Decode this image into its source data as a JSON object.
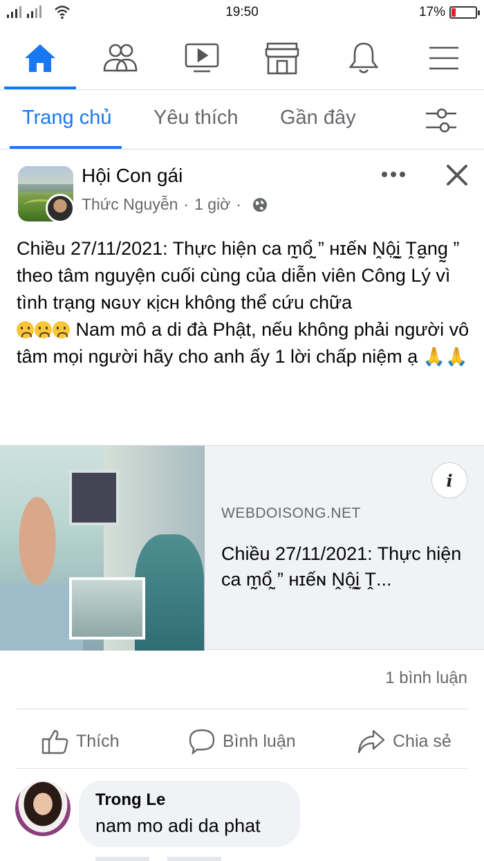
{
  "status_bar": {
    "time": "19:50",
    "battery_percent": "17%",
    "battery_level": 0.17,
    "battery_color": "#e0202a"
  },
  "top_nav": {
    "icons": [
      "home-icon",
      "friends-icon",
      "watch-icon",
      "marketplace-icon",
      "notifications-bell-icon",
      "menu-icon"
    ],
    "active_index": 0,
    "accent_color": "#1877f2"
  },
  "tabs": {
    "items": [
      "Trang chủ",
      "Yêu thích",
      "Gần đây"
    ],
    "active_index": 0,
    "filter_icon": "filter-sliders-icon"
  },
  "post": {
    "group_name": "Hội Con gái",
    "author": "Thức Nguyễn",
    "time": "1 giờ",
    "privacy_icon": "globe-icon",
    "text_line1": "Chiều 27/11/2021: Thực hiện ca m̰ổ̰ ” ʜɪếɴ Ṋộ̰ḭ Ṱa̰ng̰ ” theo tâm nguyện cuối cùng của diễn viên Công Lý vì tình trạng ɴɢᴜʏ ᴋịᴄʜ không thể cứu chữa",
    "text_line2": "Nam mô a di đà Phật, nếu không phải người vô tâm mọi người hãy cho anh ấy 1 lời chấp niệm ạ",
    "emoji_sad_count": 3,
    "hands_emoji": "🙏🙏"
  },
  "link_preview": {
    "domain": "WEBDOISONG.NET",
    "title": "Chiều 27/11/2021: Thực hiện ca m̰ổ̰ ” ʜɪếɴ Ṋộ̰ḭ Ṱ...",
    "info_label": "i"
  },
  "engagement": {
    "comment_count": "1 bình luận"
  },
  "actions": {
    "like": "Thích",
    "comment": "Bình luận",
    "share": "Chia sẻ"
  },
  "comment": {
    "name": "Trong Le",
    "text": "nam mo adi da phat"
  }
}
